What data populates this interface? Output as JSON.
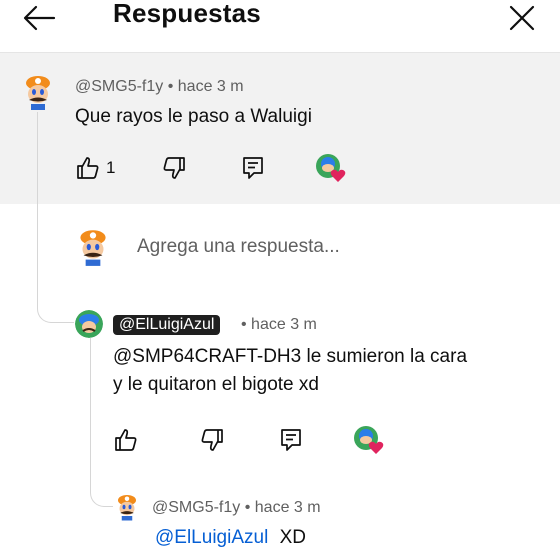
{
  "header": {
    "title": "Respuestas",
    "back_icon": "arrow-left-icon",
    "close_icon": "close-icon"
  },
  "parent_comment": {
    "handle": "@SMG5-f1y",
    "time": "• hace 3 m",
    "text": "Que rayos le paso a Waluigi",
    "like_count": "1"
  },
  "reply_box": {
    "placeholder": "Agrega una respuesta..."
  },
  "replies": [
    {
      "handle": "@ElLuigiAzul",
      "time": "• hace 3 m",
      "text_line1": "@SMP64CRAFT-DH3 le sumieron la cara",
      "text_line2": "y le quitaron el bigote xd",
      "creator_chip": true
    },
    {
      "handle": "@SMG5-f1y",
      "time": "• hace 3 m",
      "mention": "@ElLuigiAzul",
      "text": "XD"
    }
  ],
  "colors": {
    "mention": "#065fd4",
    "heart": "#e0245e",
    "parent_bg": "#f2f2f2"
  }
}
